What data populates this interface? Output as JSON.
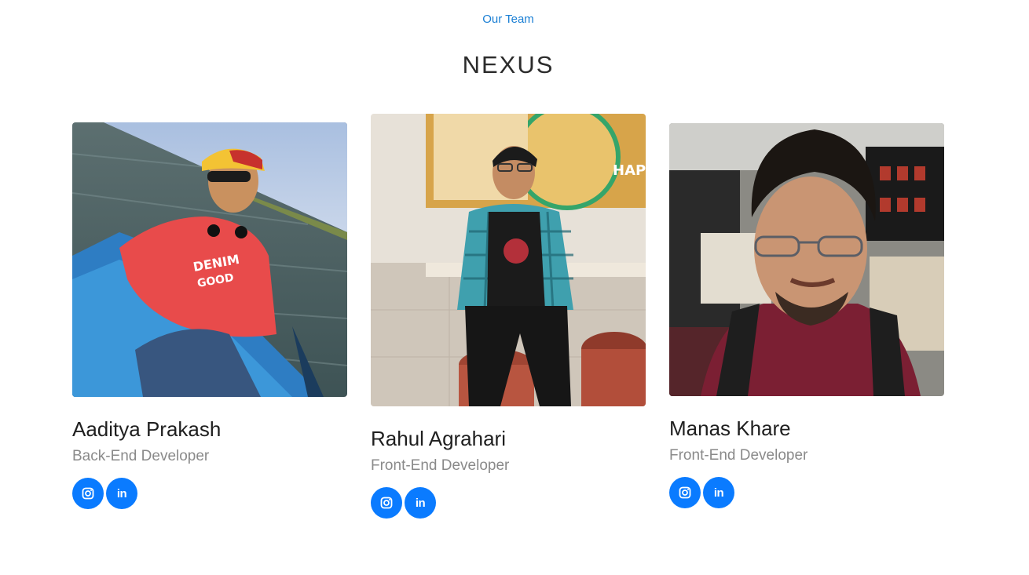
{
  "section": {
    "eyebrow": "Our Team",
    "title": "NEXUS"
  },
  "accent_color": "#0a7bff",
  "members": [
    {
      "name": "Aaditya Prakash",
      "role": "Back-End Developer",
      "photo_icon": "person-photo",
      "socials": [
        {
          "icon": "instagram-icon",
          "label": ""
        },
        {
          "icon": "linkedin-icon",
          "label": "in"
        }
      ]
    },
    {
      "name": "Rahul Agrahari",
      "role": "Front-End Developer",
      "photo_icon": "person-photo",
      "socials": [
        {
          "icon": "instagram-icon",
          "label": ""
        },
        {
          "icon": "linkedin-icon",
          "label": "in"
        }
      ]
    },
    {
      "name": "Manas Khare",
      "role": "Front-End Developer",
      "photo_icon": "person-photo",
      "socials": [
        {
          "icon": "instagram-icon",
          "label": ""
        },
        {
          "icon": "linkedin-icon",
          "label": "in"
        }
      ]
    }
  ]
}
